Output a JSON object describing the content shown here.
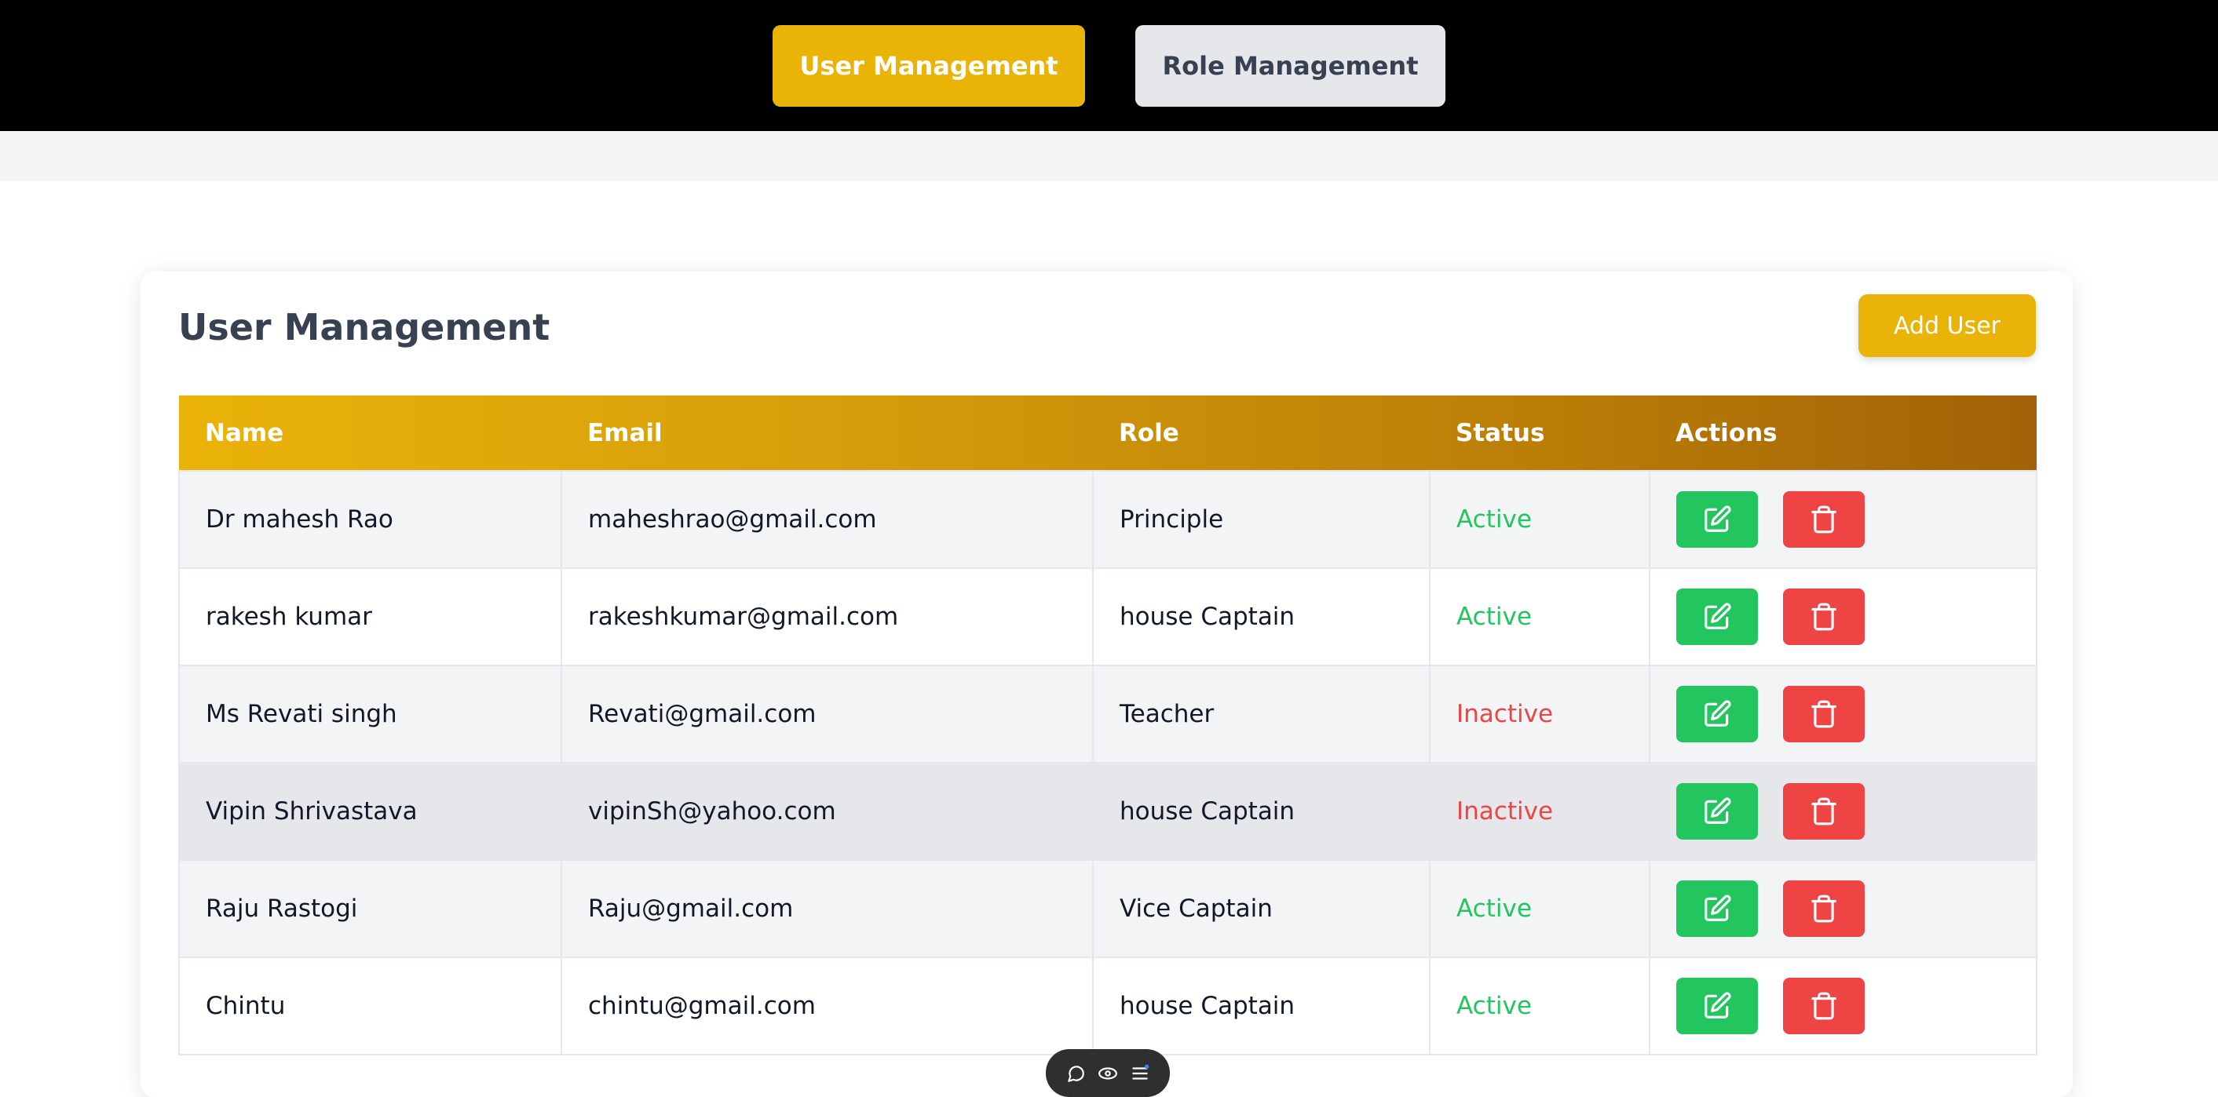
{
  "topnav": {
    "user_management": "User Management",
    "role_management": "Role Management"
  },
  "card": {
    "title": "User Management",
    "add_user": "Add User"
  },
  "table": {
    "headers": [
      "Name",
      "Email",
      "Role",
      "Status",
      "Actions"
    ],
    "rows": [
      {
        "name": "Dr mahesh Rao",
        "email": "maheshrao@gmail.com",
        "role": "Principle",
        "status": "Active"
      },
      {
        "name": "rakesh kumar",
        "email": "rakeshkumar@gmail.com",
        "role": "house Captain",
        "status": "Active"
      },
      {
        "name": "Ms Revati singh",
        "email": "Revati@gmail.com",
        "role": "Teacher",
        "status": "Inactive"
      },
      {
        "name": "Vipin Shrivastava",
        "email": "vipinSh@yahoo.com",
        "role": "house Captain",
        "status": "Inactive"
      },
      {
        "name": "Raju Rastogi",
        "email": "Raju@gmail.com",
        "role": "Vice Captain",
        "status": "Active"
      },
      {
        "name": "Chintu",
        "email": "chintu@gmail.com",
        "role": "house Captain",
        "status": "Active"
      }
    ]
  },
  "colors": {
    "accent": "#EAB308",
    "active": "#22C55E",
    "inactive": "#EF4444"
  },
  "icons": {
    "edit": "edit-icon",
    "delete": "trash-icon",
    "chat": "chat-icon",
    "eye": "eye-icon",
    "menu": "menu-icon"
  }
}
